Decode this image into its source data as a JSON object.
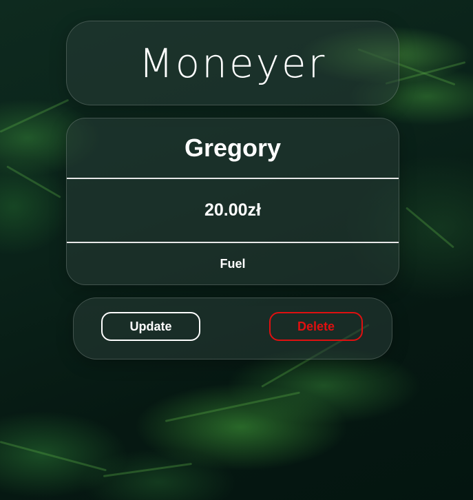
{
  "app": {
    "title": "Moneyer"
  },
  "entry": {
    "name": "Gregory",
    "amount": "20.00zł",
    "category": "Fuel"
  },
  "actions": {
    "update_label": "Update",
    "delete_label": "Delete"
  },
  "colors": {
    "text": "#ffffff",
    "delete_accent": "#e01010",
    "background_dark": "#0a2219",
    "foliage": "#5aaa46"
  }
}
